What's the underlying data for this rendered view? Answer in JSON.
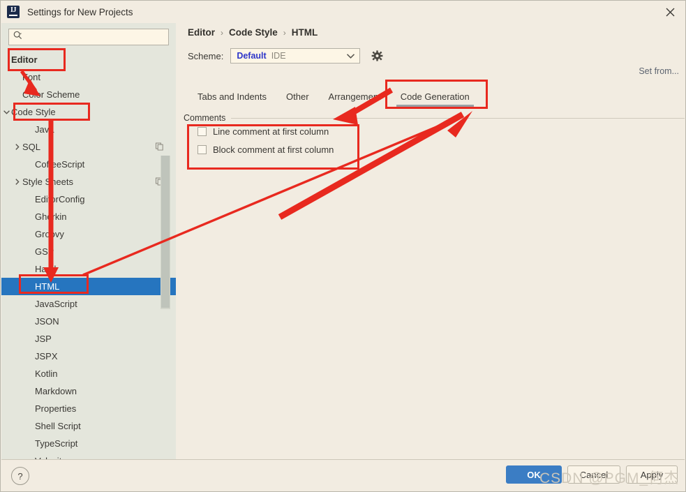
{
  "window": {
    "title": "Settings for New Projects",
    "logo_icon": "intellij-idea-logo",
    "close_icon": "close-icon"
  },
  "search": {
    "value": "",
    "placeholder": "",
    "icon": "search-icon"
  },
  "sidebar": {
    "items": [
      {
        "label": "Editor",
        "indent": 0,
        "twisty": "",
        "bold": true,
        "selected": false,
        "copy_icon": false
      },
      {
        "label": "Font",
        "indent": 1,
        "twisty": "",
        "bold": false,
        "selected": false,
        "copy_icon": false
      },
      {
        "label": "Color Scheme",
        "indent": 1,
        "twisty": "",
        "bold": false,
        "selected": false,
        "copy_icon": false
      },
      {
        "label": "Code Style",
        "indent": 0,
        "twisty": "down",
        "bold": false,
        "selected": false,
        "copy_icon": false
      },
      {
        "label": "Java",
        "indent": 2,
        "twisty": "",
        "bold": false,
        "selected": false,
        "copy_icon": false
      },
      {
        "label": "SQL",
        "indent": 1,
        "twisty": "right",
        "bold": false,
        "selected": false,
        "copy_icon": true
      },
      {
        "label": "CoffeeScript",
        "indent": 2,
        "twisty": "",
        "bold": false,
        "selected": false,
        "copy_icon": false
      },
      {
        "label": "Style Sheets",
        "indent": 1,
        "twisty": "right",
        "bold": false,
        "selected": false,
        "copy_icon": true
      },
      {
        "label": "EditorConfig",
        "indent": 2,
        "twisty": "",
        "bold": false,
        "selected": false,
        "copy_icon": false
      },
      {
        "label": "Gherkin",
        "indent": 2,
        "twisty": "",
        "bold": false,
        "selected": false,
        "copy_icon": false
      },
      {
        "label": "Groovy",
        "indent": 2,
        "twisty": "",
        "bold": false,
        "selected": false,
        "copy_icon": false
      },
      {
        "label": "GSP",
        "indent": 2,
        "twisty": "",
        "bold": false,
        "selected": false,
        "copy_icon": false
      },
      {
        "label": "Haml",
        "indent": 2,
        "twisty": "",
        "bold": false,
        "selected": false,
        "copy_icon": false
      },
      {
        "label": "HTML",
        "indent": 2,
        "twisty": "",
        "bold": false,
        "selected": true,
        "copy_icon": false
      },
      {
        "label": "JavaScript",
        "indent": 2,
        "twisty": "",
        "bold": false,
        "selected": false,
        "copy_icon": false
      },
      {
        "label": "JSON",
        "indent": 2,
        "twisty": "",
        "bold": false,
        "selected": false,
        "copy_icon": false
      },
      {
        "label": "JSP",
        "indent": 2,
        "twisty": "",
        "bold": false,
        "selected": false,
        "copy_icon": false
      },
      {
        "label": "JSPX",
        "indent": 2,
        "twisty": "",
        "bold": false,
        "selected": false,
        "copy_icon": false
      },
      {
        "label": "Kotlin",
        "indent": 2,
        "twisty": "",
        "bold": false,
        "selected": false,
        "copy_icon": false
      },
      {
        "label": "Markdown",
        "indent": 2,
        "twisty": "",
        "bold": false,
        "selected": false,
        "copy_icon": false
      },
      {
        "label": "Properties",
        "indent": 2,
        "twisty": "",
        "bold": false,
        "selected": false,
        "copy_icon": false
      },
      {
        "label": "Shell Script",
        "indent": 2,
        "twisty": "",
        "bold": false,
        "selected": false,
        "copy_icon": false
      },
      {
        "label": "TypeScript",
        "indent": 2,
        "twisty": "",
        "bold": false,
        "selected": false,
        "copy_icon": false
      },
      {
        "label": "Velocity",
        "indent": 2,
        "twisty": "",
        "bold": false,
        "selected": false,
        "copy_icon": false
      }
    ]
  },
  "breadcrumb": {
    "parts": [
      "Editor",
      "Code Style",
      "HTML"
    ],
    "separator": "›"
  },
  "scheme": {
    "label": "Scheme:",
    "value": "Default",
    "scope": "IDE",
    "gear_icon": "gear-icon",
    "dropdown_icon": "chevron-down-icon"
  },
  "set_from": {
    "label": "Set from..."
  },
  "tabs": [
    {
      "label": "Tabs and Indents",
      "active": false
    },
    {
      "label": "Other",
      "active": false
    },
    {
      "label": "Arrangement",
      "active": false
    },
    {
      "label": "Code Generation",
      "active": true
    }
  ],
  "comments_group": {
    "title": "Comments",
    "options": [
      {
        "label": "Line comment at first column",
        "checked": false
      },
      {
        "label": "Block comment at first column",
        "checked": false
      }
    ]
  },
  "footer": {
    "help_label": "?",
    "ok_label": "OK",
    "cancel_label": "Cancel",
    "apply_label": "Apply"
  },
  "watermark": {
    "text": "CSDN @PGM_何杰"
  },
  "colors": {
    "accent_blue": "#2675bf",
    "button_blue": "#3b7dc4",
    "annotation_red": "#e8291f",
    "sidebar_bg": "#e4e6dc",
    "panel_bg": "#f2ece1",
    "scheme_value_blue": "#2e36c9"
  }
}
